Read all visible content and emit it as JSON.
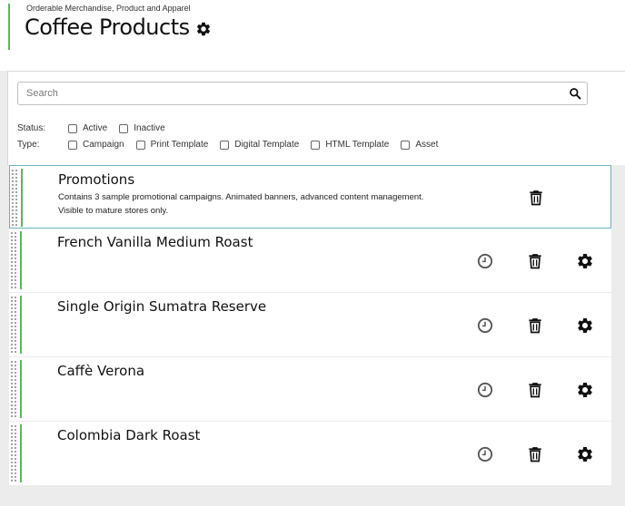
{
  "header": {
    "subtitle": "Orderable Merchandise, Product and Apparel",
    "title": "Coffee Products"
  },
  "search": {
    "placeholder": "Search",
    "value": ""
  },
  "filters": {
    "status": {
      "label": "Status:",
      "options": [
        {
          "label": "Active",
          "checked": false
        },
        {
          "label": "Inactive",
          "checked": false
        }
      ]
    },
    "type": {
      "label": "Type:",
      "options": [
        {
          "label": "Campaign",
          "checked": false
        },
        {
          "label": "Print Template",
          "checked": false
        },
        {
          "label": "Digital Template",
          "checked": false
        },
        {
          "label": "HTML Template",
          "checked": false
        },
        {
          "label": "Asset",
          "checked": false
        }
      ]
    }
  },
  "items": [
    {
      "title": "Promotions",
      "description_line1": "Contains 3 sample promotional campaigns. Animated banners, advanced content management.",
      "description_line2": "Visible to mature stores only.",
      "selected": true
    },
    {
      "title": "French Vanilla Medium Roast"
    },
    {
      "title": "Single Origin Sumatra Reserve"
    },
    {
      "title": "Caffè Verona"
    },
    {
      "title": "Colombia Dark Roast"
    }
  ],
  "colors": {
    "accent_green": "#5cb85c",
    "selected_border": "#69b3c0",
    "icon_dark": "#111111",
    "icon_gray": "#555555"
  },
  "icons": {
    "title": "gear-icon",
    "search": "search-icon",
    "row_actions": [
      "clock-icon",
      "trash-icon",
      "gear-icon"
    ]
  }
}
